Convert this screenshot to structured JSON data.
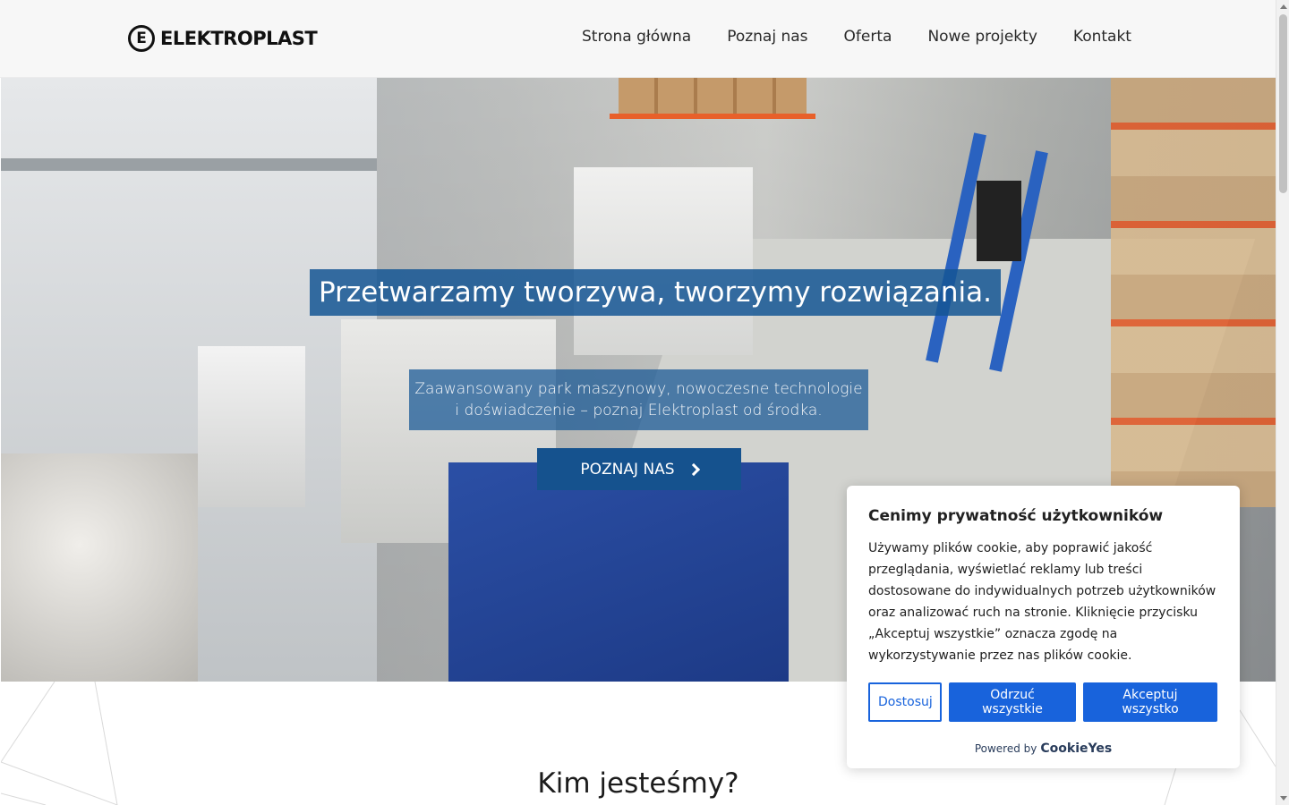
{
  "header": {
    "logo_mark": "E",
    "logo_text": "ELEKTROPLAST",
    "nav": [
      {
        "label": "Strona główna"
      },
      {
        "label": "Poznaj nas"
      },
      {
        "label": "Oferta"
      },
      {
        "label": "Nowe projekty"
      },
      {
        "label": "Kontakt"
      }
    ]
  },
  "hero": {
    "title": "Przetwarzamy tworzywa, tworzymy rozwiązania.",
    "subtitle": "Zaawansowany park maszynowy, nowoczesne technologie i doświadczenie – poznaj Elektroplast od środka.",
    "button_label": "POZNAJ NAS"
  },
  "section": {
    "title": "Kim jesteśmy?"
  },
  "cookie_banner": {
    "title": "Cenimy prywatność użytkowników",
    "body": "Używamy plików cookie, aby poprawić jakość przeglądania, wyświetlać reklamy lub treści dostosowane do indywidualnych potrzeb użytkowników oraz analizować ruch na stronie. Kliknięcie przycisku „Akceptuj wszystkie” oznacza zgodę na wykorzystywanie przez nas plików cookie.",
    "customize_label": "Dostosuj",
    "reject_label": "Odrzuć wszystkie",
    "accept_label": "Akceptuj wszystko",
    "powered_by": "Powered by",
    "powered_brand": "CookieYes"
  },
  "colors": {
    "brand_blue": "#15528e",
    "cookie_blue": "#1863dc"
  }
}
